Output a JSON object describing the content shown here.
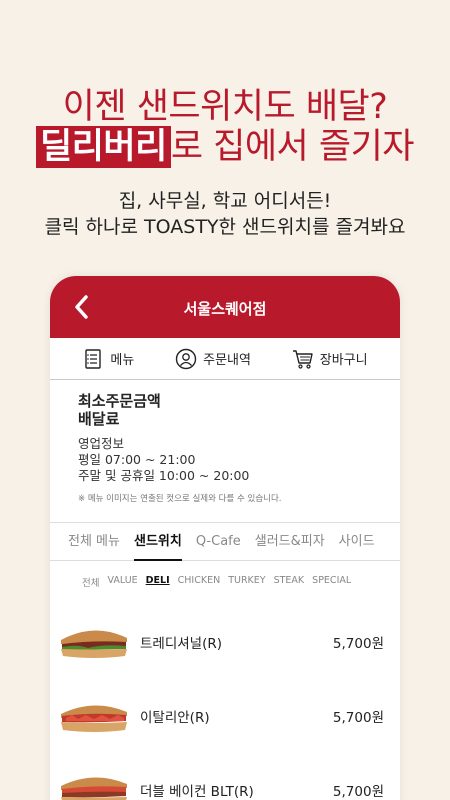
{
  "promo": {
    "headline_line1": "이젠 샌드위치도 배달?",
    "headline_highlight": "딜리버리",
    "headline_line2_rest": "로 집에서 즐기자",
    "sub_line1": "집, 사무실, 학교 어디서든!",
    "sub_line2": "클릭 하나로 TOASTY한 샌드위치를 즐겨봐요"
  },
  "app": {
    "title": "서울스퀘어점",
    "nav": [
      {
        "label": "메뉴",
        "icon": "menu-list-icon"
      },
      {
        "label": "주문내역",
        "icon": "user-icon"
      },
      {
        "label": "장바구니",
        "icon": "cart-icon"
      }
    ],
    "info": {
      "min_order": "최소주문금액",
      "delivery_fee": "배달료",
      "hours_title": "영업정보",
      "weekday": "평일 07:00 ~ 21:00",
      "weekend": "주말 및 공휴일 10:00 ~ 20:00",
      "notice": "※ 메뉴 이미지는 연출된 컷으로 실제와 다를 수 있습니다."
    },
    "categories": [
      "전체 메뉴",
      "샌드위치",
      "Q-Cafe",
      "샐러드&피자",
      "사이드"
    ],
    "active_category": "샌드위치",
    "subcategories": [
      "전체",
      "VALUE",
      "DELI",
      "CHICKEN",
      "TURKEY",
      "STEAK",
      "SPECIAL"
    ],
    "active_subcategory": "DELI",
    "items": [
      {
        "name": "트레디셔널(R)",
        "price": "5,700원"
      },
      {
        "name": "이탈리안(R)",
        "price": "5,700원"
      },
      {
        "name": "더블 베이컨 BLT(R)",
        "price": "5,700원"
      }
    ]
  },
  "colors": {
    "brand_red": "#b81a2c",
    "background": "#f7f1e7"
  }
}
